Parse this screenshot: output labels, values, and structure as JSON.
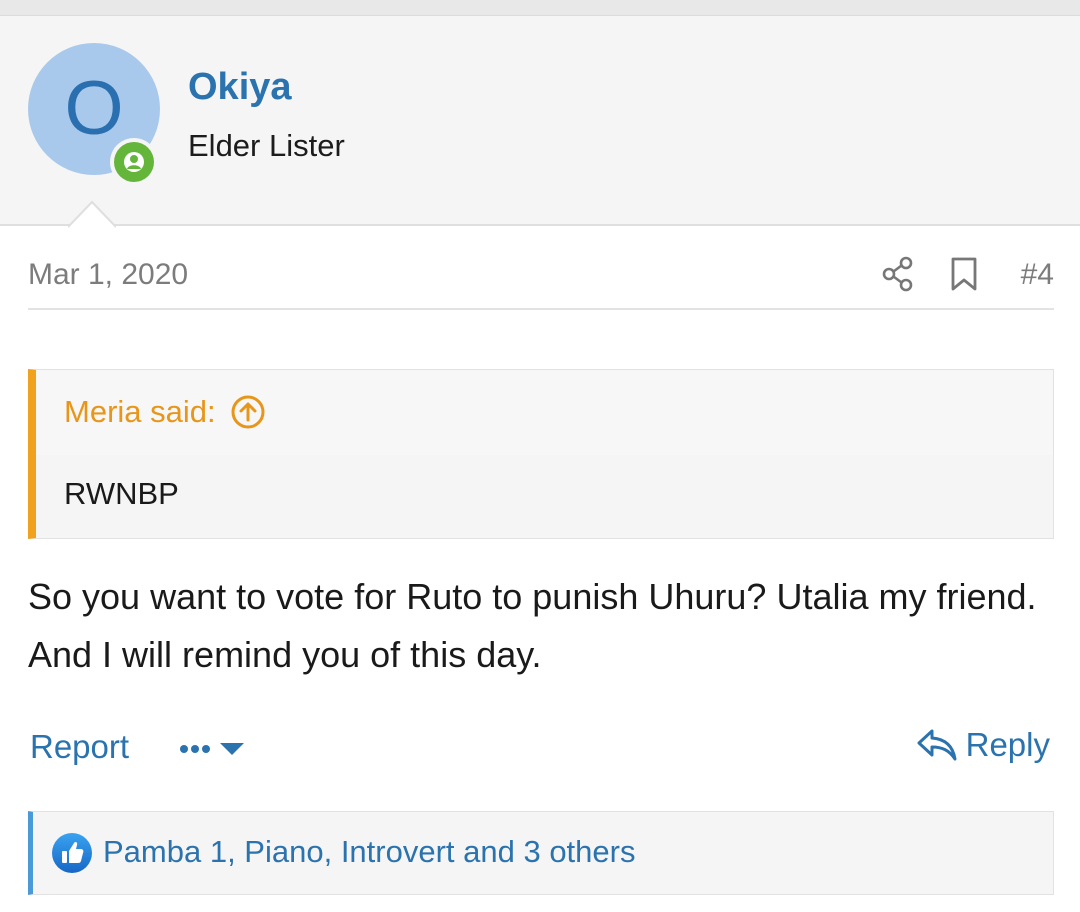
{
  "post": {
    "author": {
      "initial": "O",
      "name": "Okiya",
      "title": "Elder Lister",
      "avatar_color": "#a9c9ec",
      "online_badge_color": "#63b63a"
    },
    "date": "Mar 1, 2020",
    "number": "#4",
    "icons": {
      "share": "share-icon",
      "bookmark": "bookmark-icon"
    },
    "quote": {
      "author_label": "Meria said:",
      "text": "RWNBP",
      "accent_color": "#f0a11d"
    },
    "body": "So you want to vote for Ruto to punish Uhuru? Utalia my friend. And I will remind you of this day.",
    "actions": {
      "report_label": "Report",
      "more_label": "•••",
      "reply_label": "Reply"
    },
    "reactions": {
      "text": "Pamba 1, Piano, Introvert and 3 others",
      "icon": "like-icon"
    }
  },
  "colors": {
    "link": "#2b73ae",
    "quote_accent": "#f0a11d",
    "reaction_accent": "#4a9ad8"
  }
}
